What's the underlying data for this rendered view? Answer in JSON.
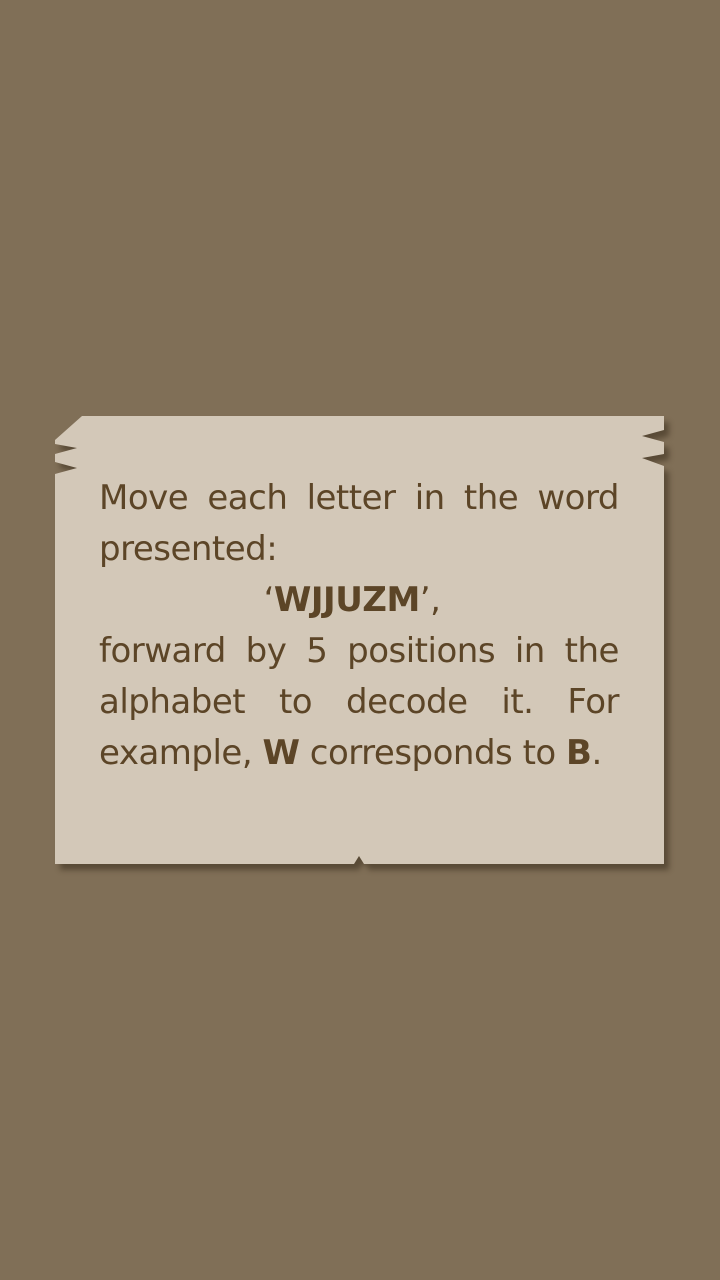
{
  "card": {
    "paper_color": "#d3c8b8",
    "text_color": "#5c4527",
    "line1": [
      "Move",
      "each",
      "letter",
      "in",
      "the",
      "word"
    ],
    "line2": "presented:",
    "word_open_quote": "‘",
    "encoded_word": "WJJUZM",
    "word_close_quote": "’,",
    "line4": [
      "forward",
      "by",
      "5",
      "positions",
      "in",
      "the"
    ],
    "line5": [
      "alphabet",
      "to",
      "decode",
      "it.",
      "For"
    ],
    "example_prefix": "example,",
    "example_from": "W",
    "example_middle": "corresponds to",
    "example_to": "B",
    "example_end": "."
  },
  "background_color": "#806f57"
}
